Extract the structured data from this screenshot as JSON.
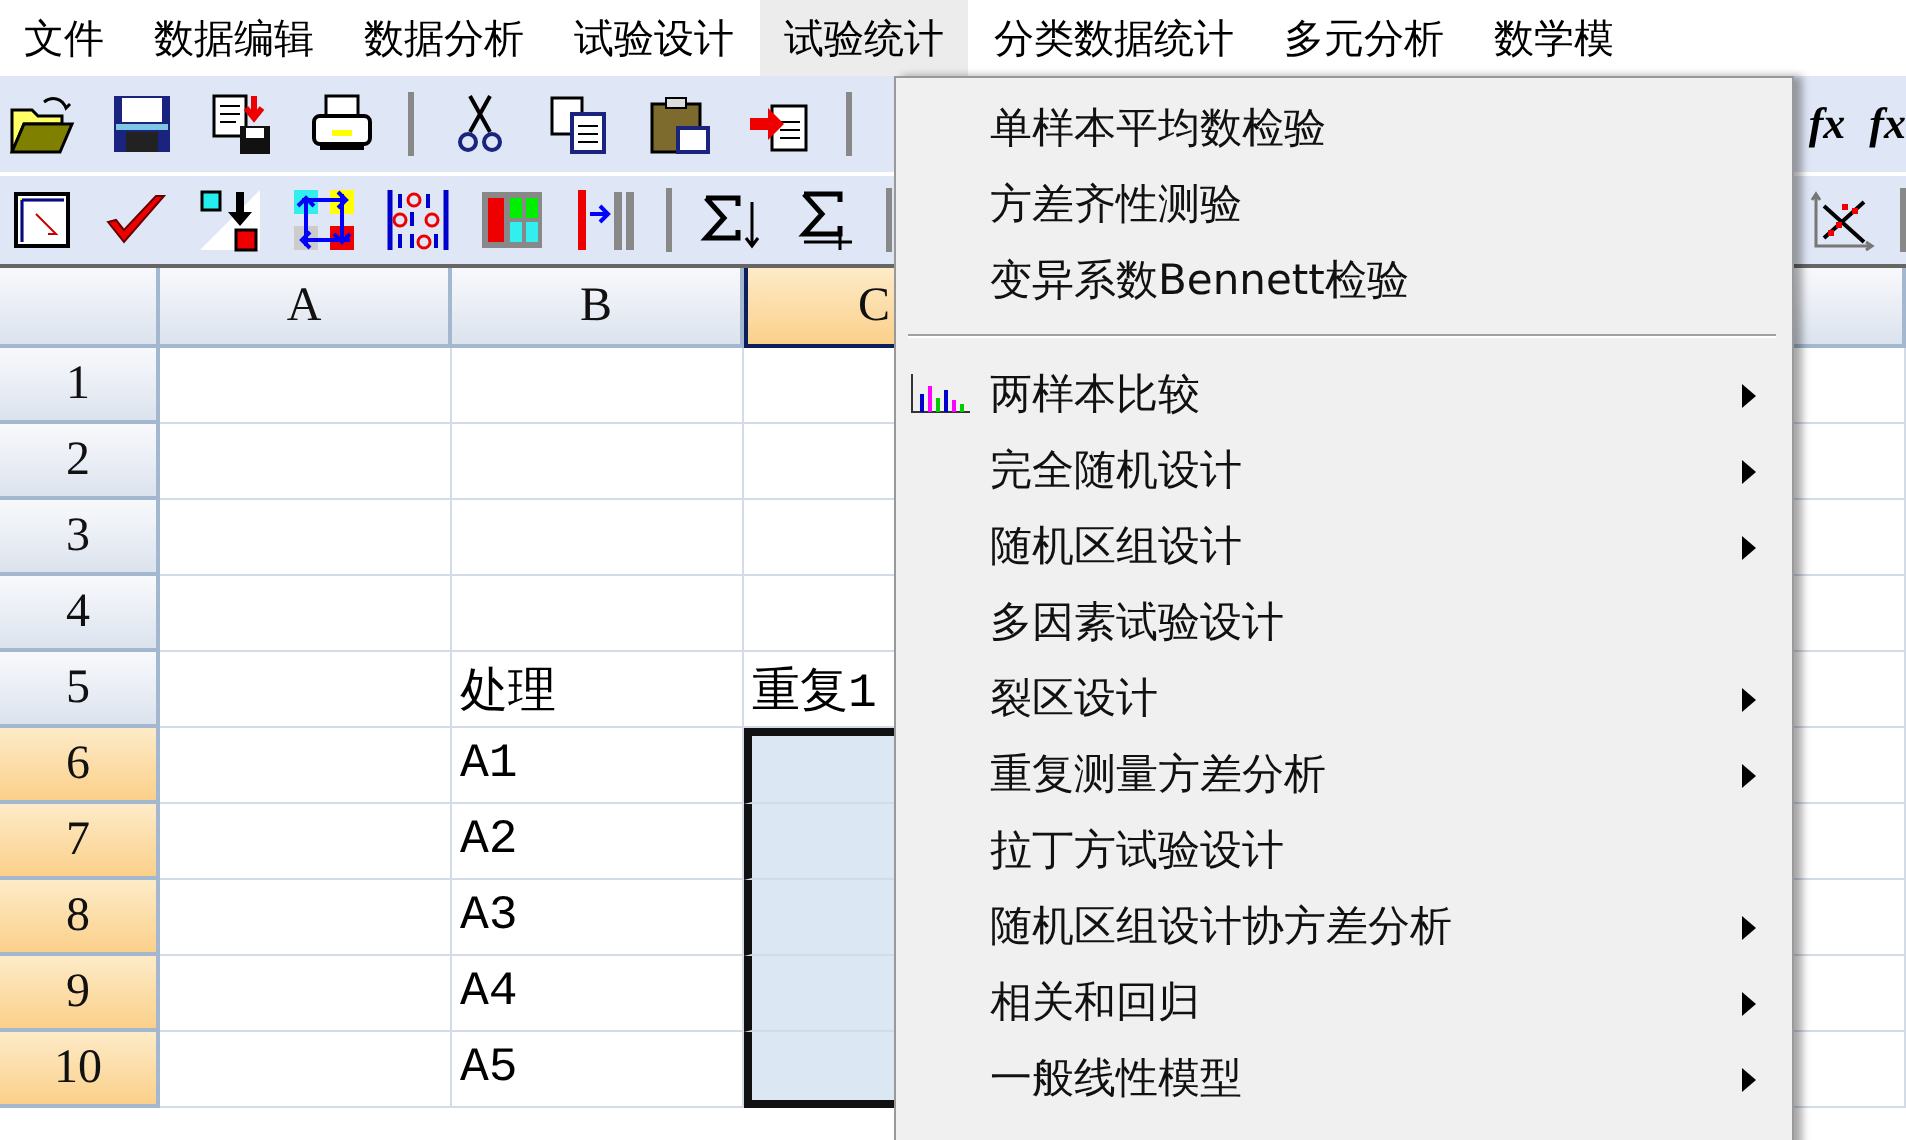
{
  "menubar": [
    {
      "label": "文件",
      "selected": false
    },
    {
      "label": "数据编辑",
      "selected": false
    },
    {
      "label": "数据分析",
      "selected": false
    },
    {
      "label": "试验设计",
      "selected": false
    },
    {
      "label": "试验统计",
      "selected": true
    },
    {
      "label": "分类数据统计",
      "selected": false
    },
    {
      "label": "多元分析",
      "selected": false
    },
    {
      "label": "数学模",
      "selected": false
    }
  ],
  "toolbar": {
    "function_buttons": [
      "fx",
      "fx"
    ]
  },
  "grid": {
    "columns": [
      {
        "label": "A",
        "selected": false
      },
      {
        "label": "B",
        "selected": false
      },
      {
        "label": "C",
        "selected": true
      }
    ],
    "rows": [
      {
        "label": "1",
        "selected": false
      },
      {
        "label": "2",
        "selected": false
      },
      {
        "label": "3",
        "selected": false
      },
      {
        "label": "4",
        "selected": false
      },
      {
        "label": "5",
        "selected": false,
        "cell_b": "处理",
        "cell_c": "重复1"
      },
      {
        "label": "6",
        "selected": true,
        "cell_b": "A1"
      },
      {
        "label": "7",
        "selected": true,
        "cell_b": "A2"
      },
      {
        "label": "8",
        "selected": true,
        "cell_b": "A3"
      },
      {
        "label": "9",
        "selected": true,
        "cell_b": "A4"
      },
      {
        "label": "10",
        "selected": true,
        "cell_b": "A5"
      }
    ]
  },
  "menu": {
    "items": [
      {
        "kind": "item",
        "label": "单样本平均数检验",
        "has_submenu": false
      },
      {
        "kind": "item",
        "label": "方差齐性测验",
        "has_submenu": false
      },
      {
        "kind": "item",
        "label": "变异系数Bennett检验",
        "has_submenu": false
      },
      {
        "kind": "separator"
      },
      {
        "kind": "icon_item",
        "label": "两样本比较",
        "has_submenu": true
      },
      {
        "kind": "item",
        "label": "完全随机设计",
        "has_submenu": true
      },
      {
        "kind": "item",
        "label": "随机区组设计",
        "has_submenu": true
      },
      {
        "kind": "item",
        "label": "多因素试验设计",
        "has_submenu": false
      },
      {
        "kind": "item",
        "label": "裂区设计",
        "has_submenu": true
      },
      {
        "kind": "item",
        "label": "重复测量方差分析",
        "has_submenu": true
      },
      {
        "kind": "item",
        "label": "拉丁方试验设计",
        "has_submenu": false
      },
      {
        "kind": "item",
        "label": "随机区组设计协方差分析",
        "has_submenu": true
      },
      {
        "kind": "item",
        "label": "相关和回归",
        "has_submenu": true
      },
      {
        "kind": "item",
        "label": "一般线性模型",
        "has_submenu": true
      }
    ]
  }
}
